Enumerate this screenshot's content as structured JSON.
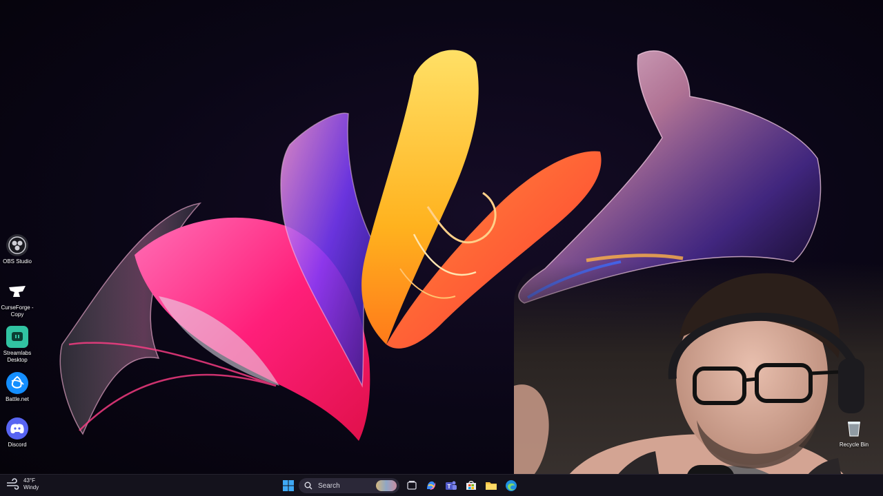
{
  "desktop": {
    "icons": [
      {
        "name": "obs-studio",
        "label": "OBS Studio",
        "icon": "obs-icon",
        "color": "#3a3a44"
      },
      {
        "name": "curseforge-copy",
        "label": "CurseForge -\nCopy",
        "icon": "curseforge-icon",
        "color": "#1b1b22"
      },
      {
        "name": "streamlabs-desktop",
        "label": "Streamlabs\nDesktop",
        "icon": "streamlabs-icon",
        "color": "#31c3a2"
      },
      {
        "name": "battle-net",
        "label": "Battle.net",
        "icon": "battlenet-icon",
        "color": "#148eff"
      },
      {
        "name": "discord",
        "label": "Discord",
        "icon": "discord-icon",
        "color": "#5865f2"
      }
    ],
    "recycle_bin": {
      "label": "Recycle Bin",
      "icon": "recycle-bin-icon"
    }
  },
  "taskbar": {
    "weather": {
      "temp": "43°F",
      "condition": "Windy",
      "icon": "wind-icon"
    },
    "start": {
      "icon": "windows-start-icon",
      "color": "#3fa9f5"
    },
    "search": {
      "placeholder": "Search",
      "icon": "search-icon"
    },
    "apps": [
      {
        "name": "task-view",
        "icon": "task-view-icon"
      },
      {
        "name": "copilot",
        "icon": "copilot-icon"
      },
      {
        "name": "teams",
        "icon": "teams-icon"
      },
      {
        "name": "store",
        "icon": "microsoft-store-icon"
      },
      {
        "name": "file-explorer",
        "icon": "folder-icon"
      },
      {
        "name": "edge",
        "icon": "edge-icon"
      }
    ]
  }
}
